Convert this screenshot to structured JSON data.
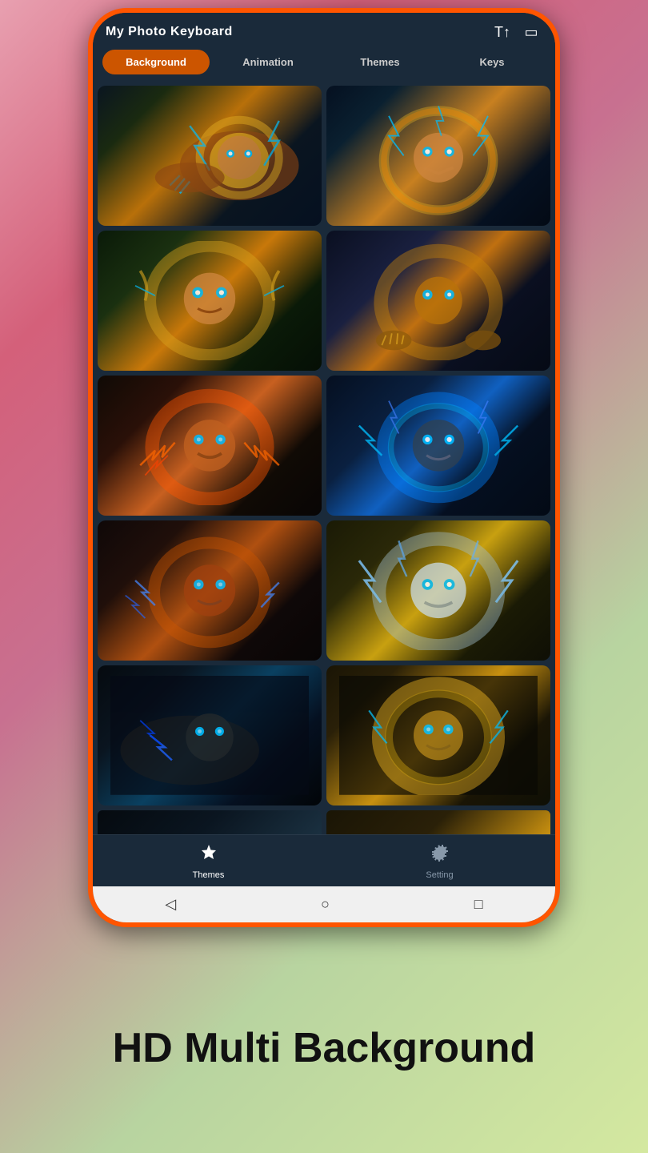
{
  "app": {
    "title": "My Photo Keyboard",
    "header_icon_font": "T↑",
    "header_icon_menu": "▭"
  },
  "tabs": [
    {
      "label": "Background",
      "active": true
    },
    {
      "label": "Animation",
      "active": false
    },
    {
      "label": "Themes",
      "active": false
    },
    {
      "label": "Keys",
      "active": false
    }
  ],
  "grid": {
    "images": [
      {
        "id": 1,
        "alt": "Lion running with blue fire neon",
        "bg_class": "lion-bg-1"
      },
      {
        "id": 2,
        "alt": "Lion roaring with blue electric neon",
        "bg_class": "lion-bg-2"
      },
      {
        "id": 3,
        "alt": "Lion face frontal glowing blue eyes",
        "bg_class": "lion-bg-3"
      },
      {
        "id": 4,
        "alt": "Lion with golden neon mane crouching",
        "bg_class": "lion-bg-4"
      },
      {
        "id": 5,
        "alt": "Lion roaring orange fire claws",
        "bg_class": "lion-bg-5"
      },
      {
        "id": 6,
        "alt": "Lion roaring blue electric storm",
        "bg_class": "lion-bg-6"
      },
      {
        "id": 7,
        "alt": "Lion orange fire lightning claws",
        "bg_class": "lion-bg-7"
      },
      {
        "id": 8,
        "alt": "White lion roaring blue lightning",
        "bg_class": "lion-bg-8"
      },
      {
        "id": 9,
        "alt": "Dark lion blue lightning crawling",
        "bg_class": "lion-bg-9"
      },
      {
        "id": 10,
        "alt": "Golden lion golden neon fire glow",
        "bg_class": "lion-bg-10"
      }
    ]
  },
  "bottom_nav": [
    {
      "label": "Themes",
      "icon": "⬡",
      "active": true
    },
    {
      "label": "Setting",
      "icon": "⚙",
      "active": false
    }
  ],
  "android_nav": {
    "back": "◁",
    "home": "○",
    "recent": "□"
  },
  "footer_text": "HD Multi Background",
  "partial_items": [
    {
      "bg_class": "lion-bg-9"
    },
    {
      "bg_class": "lion-bg-10"
    }
  ]
}
